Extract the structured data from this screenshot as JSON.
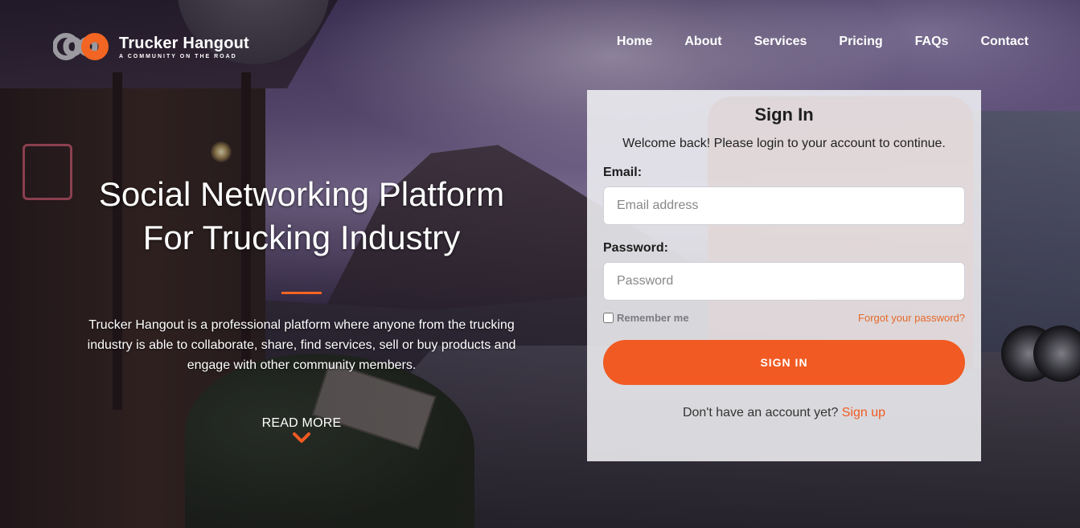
{
  "brand": {
    "name": "Trucker Hangout",
    "tagline": "A COMMUNITY ON THE ROAD",
    "colors": {
      "accent": "#f15a22",
      "logo_orange": "#f26522",
      "logo_gray": "#9a9aa0"
    }
  },
  "nav": {
    "items": [
      {
        "label": "Home"
      },
      {
        "label": "About"
      },
      {
        "label": "Services"
      },
      {
        "label": "Pricing"
      },
      {
        "label": "FAQs"
      },
      {
        "label": "Contact"
      }
    ]
  },
  "hero": {
    "title_line1": "Social Networking Platform",
    "title_line2": "For Trucking Industry",
    "description": "Trucker Hangout is a professional platform where anyone from the trucking industry is able to collaborate, share, find services, sell or buy products and engage with other community members.",
    "read_more": "READ MORE",
    "read_more_icon": "chevron-down-icon"
  },
  "signin": {
    "title": "Sign In",
    "subtitle": "Welcome back! Please login to your account to continue.",
    "email_label": "Email:",
    "email_placeholder": "Email address",
    "email_value": "",
    "password_label": "Password:",
    "password_placeholder": "Password",
    "password_value": "",
    "remember_label": "Remember me",
    "remember_checked": false,
    "forgot_label": "Forgot your password?",
    "submit_label": "SIGN IN",
    "signup_prompt": "Don't have an account yet?",
    "signup_link": "Sign up"
  }
}
